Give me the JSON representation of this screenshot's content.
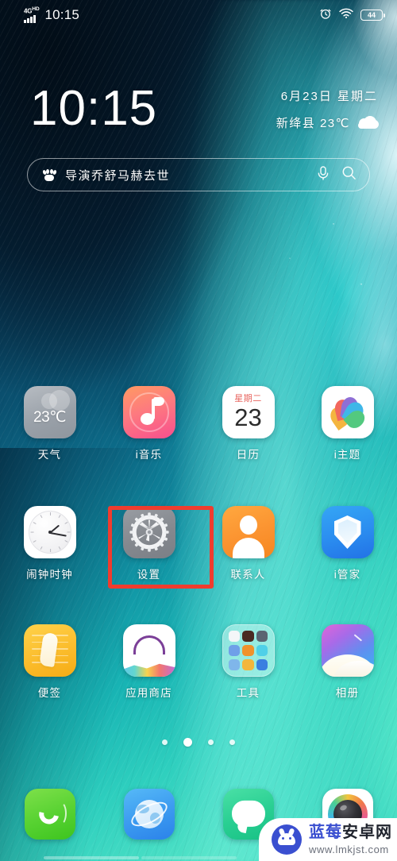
{
  "status_bar": {
    "network_type": "4G",
    "network_suffix": "HD",
    "signal_bars": 4,
    "time": "10:15",
    "alarm_icon": "alarm-clock-icon",
    "wifi_icon": "wifi-icon",
    "battery_percent": "44"
  },
  "clock_widget": {
    "time": "10:15",
    "date": "6月23日 星期二",
    "location": "新绛县 23℃",
    "weather_icon": "cloud-icon"
  },
  "search": {
    "brand_icon": "baidu-paw-icon",
    "query_text": "导演乔舒马赫去世",
    "mic_icon": "microphone-icon",
    "search_icon": "magnifier-icon"
  },
  "home_rows": [
    {
      "row": 1,
      "apps": [
        {
          "label": "天气",
          "icon": "weather-icon",
          "badge_text": "23℃"
        },
        {
          "label": "i音乐",
          "icon": "music-icon"
        },
        {
          "label": "日历",
          "icon": "calendar-icon",
          "weekday": "星期二",
          "day": "23"
        },
        {
          "label": "i主题",
          "icon": "theme-icon"
        }
      ]
    },
    {
      "row": 2,
      "apps": [
        {
          "label": "闹钟时钟",
          "icon": "alarm-clock-app-icon"
        },
        {
          "label": "设置",
          "icon": "settings-gear-icon",
          "highlighted": true
        },
        {
          "label": "联系人",
          "icon": "contacts-icon"
        },
        {
          "label": "i管家",
          "icon": "shield-manager-icon"
        }
      ]
    },
    {
      "row": 3,
      "apps": [
        {
          "label": "便签",
          "icon": "notes-icon"
        },
        {
          "label": "应用商店",
          "icon": "app-store-icon"
        },
        {
          "label": "工具",
          "icon": "folder-icon"
        },
        {
          "label": "相册",
          "icon": "gallery-icon"
        }
      ]
    }
  ],
  "folder_mini_colors": [
    "#f4f6f8",
    "#f0f1f3",
    "#5b6472",
    "#6f9fe8",
    "#f0922c",
    "#4fd0e8",
    "#7fb6ea",
    "#f3b63c",
    "#3a7fe0"
  ],
  "page_indicator": {
    "total": 4,
    "active_index": 1
  },
  "dock": [
    {
      "label": "phone",
      "icon": "phone-icon"
    },
    {
      "label": "browser",
      "icon": "browser-globe-icon"
    },
    {
      "label": "messages",
      "icon": "message-bubble-icon"
    },
    {
      "label": "camera",
      "icon": "camera-icon"
    }
  ],
  "highlight": {
    "target": "设置",
    "color": "#f03c2e"
  },
  "watermark": {
    "mascot_icon": "android-mascot-icon",
    "brand_blue": "蓝莓",
    "brand_dark": "安卓网",
    "url": "www.lmkjst.com"
  },
  "colors": {
    "accent_red": "#f03c2e",
    "wallpaper_dark": "#04131f",
    "wallpaper_teal": "#2ecfbe",
    "brand_blue": "#3a4fd0"
  }
}
